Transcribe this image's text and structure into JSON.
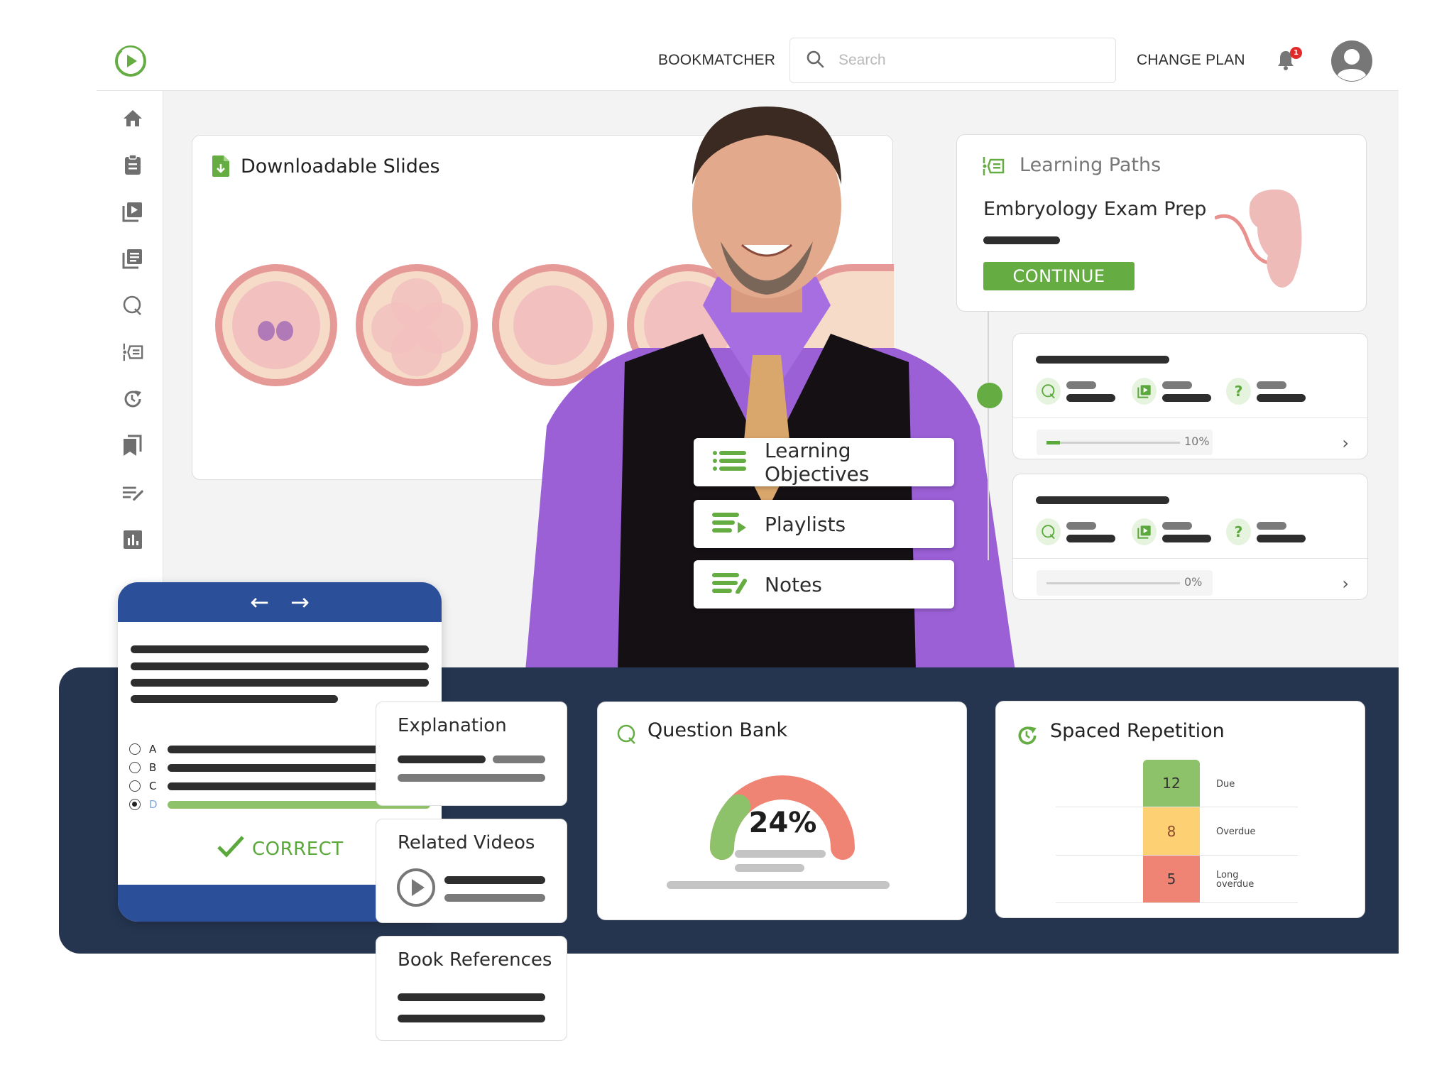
{
  "header": {
    "logo": "play-circle-logo",
    "bookmatcher_label": "BOOKMATCHER",
    "search_placeholder": "Search",
    "search_value": "",
    "change_plan_label": "CHANGE PLAN",
    "notification_count": "1",
    "avatar": "user-avatar-icon"
  },
  "sidebar": {
    "items": [
      {
        "icon": "home-icon"
      },
      {
        "icon": "clipboard-icon"
      },
      {
        "icon": "video-library-icon"
      },
      {
        "icon": "notes-library-icon"
      },
      {
        "icon": "question-bank-icon"
      },
      {
        "icon": "learning-paths-icon"
      },
      {
        "icon": "spaced-repetition-icon"
      },
      {
        "icon": "bookmarks-icon"
      },
      {
        "icon": "edit-notes-icon"
      },
      {
        "icon": "analytics-icon"
      }
    ]
  },
  "slides": {
    "title": "Downloadable Slides",
    "icon": "file-download-icon"
  },
  "learning_paths": {
    "title": "Learning Paths",
    "path_name": "Embryology Exam Prep",
    "continue_label": "CONTINUE",
    "steps": [
      {
        "progress_label": "10%",
        "progress": 10,
        "active": true
      },
      {
        "progress_label": "0%",
        "progress": 0,
        "active": false
      }
    ]
  },
  "menu": {
    "items": [
      {
        "label": "Learning Objectives",
        "icon": "list-icon"
      },
      {
        "label": "Playlists",
        "icon": "playlist-icon"
      },
      {
        "label": "Notes",
        "icon": "notes-icon"
      }
    ]
  },
  "quiz": {
    "options": [
      "A",
      "B",
      "C",
      "D"
    ],
    "selected": "D",
    "result_label": "CORRECT"
  },
  "tiles": {
    "explanation": "Explanation",
    "related_videos": "Related Videos",
    "book_references": "Book References"
  },
  "question_bank": {
    "title": "Question Bank",
    "percent_label": "24%",
    "percent": 24
  },
  "spaced_repetition": {
    "title": "Spaced Repetition",
    "rows": [
      {
        "value": "12",
        "label": "Due",
        "color": "#8dc26a"
      },
      {
        "value": "8",
        "label": "Overdue",
        "color": "#fdd173"
      },
      {
        "value": "5",
        "label": "Long overdue",
        "color": "#f08474"
      }
    ]
  },
  "colors": {
    "accent_green": "#65ad43",
    "navy": "#253550",
    "quiz_blue": "#2c4f99",
    "gauge_green": "#8dc26a",
    "gauge_red": "#f08474"
  }
}
